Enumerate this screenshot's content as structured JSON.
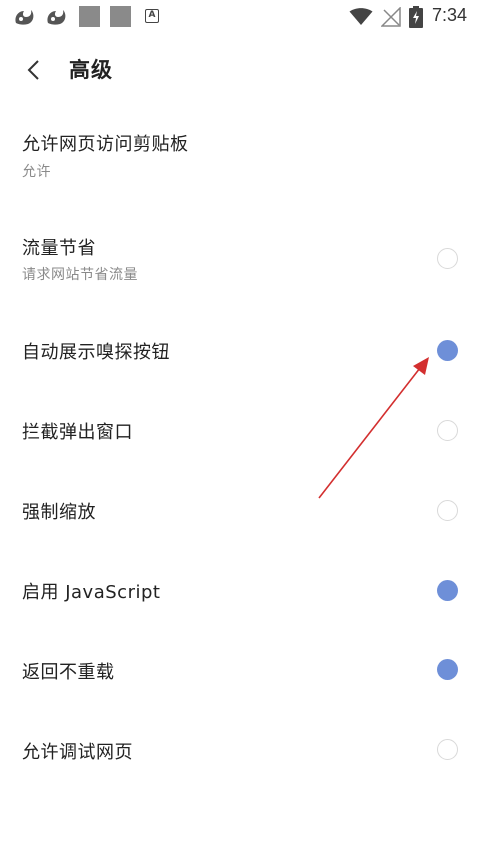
{
  "status_bar": {
    "time": "7:34",
    "app_badge": "A",
    "icons": [
      "uc-browser-icon",
      "uc-browser-icon",
      "notification-square-icon",
      "notification-square-icon",
      "keyboard-a-icon",
      "wifi-icon",
      "no-signal-icon",
      "battery-icon"
    ]
  },
  "header": {
    "title": "高级",
    "back_icon": "chevron-left-icon"
  },
  "settings": [
    {
      "title": "允许网页访问剪贴板",
      "subtitle": "允许",
      "toggle": null
    },
    {
      "title": "流量节省",
      "subtitle": "请求网站节省流量",
      "toggle": false
    },
    {
      "title": "自动展示嗅探按钮",
      "subtitle": "",
      "toggle": true
    },
    {
      "title": "拦截弹出窗口",
      "subtitle": "",
      "toggle": false
    },
    {
      "title": "强制缩放",
      "subtitle": "",
      "toggle": false
    },
    {
      "title": "启用 JavaScript",
      "subtitle": "",
      "toggle": true
    },
    {
      "title": "返回不重载",
      "subtitle": "",
      "toggle": true
    },
    {
      "title": "允许调试网页",
      "subtitle": "",
      "toggle": false
    }
  ],
  "colors": {
    "accent": "#6e8fd8",
    "radio_off_border": "#d9d9d9",
    "annotation_arrow": "#d32f2f"
  }
}
